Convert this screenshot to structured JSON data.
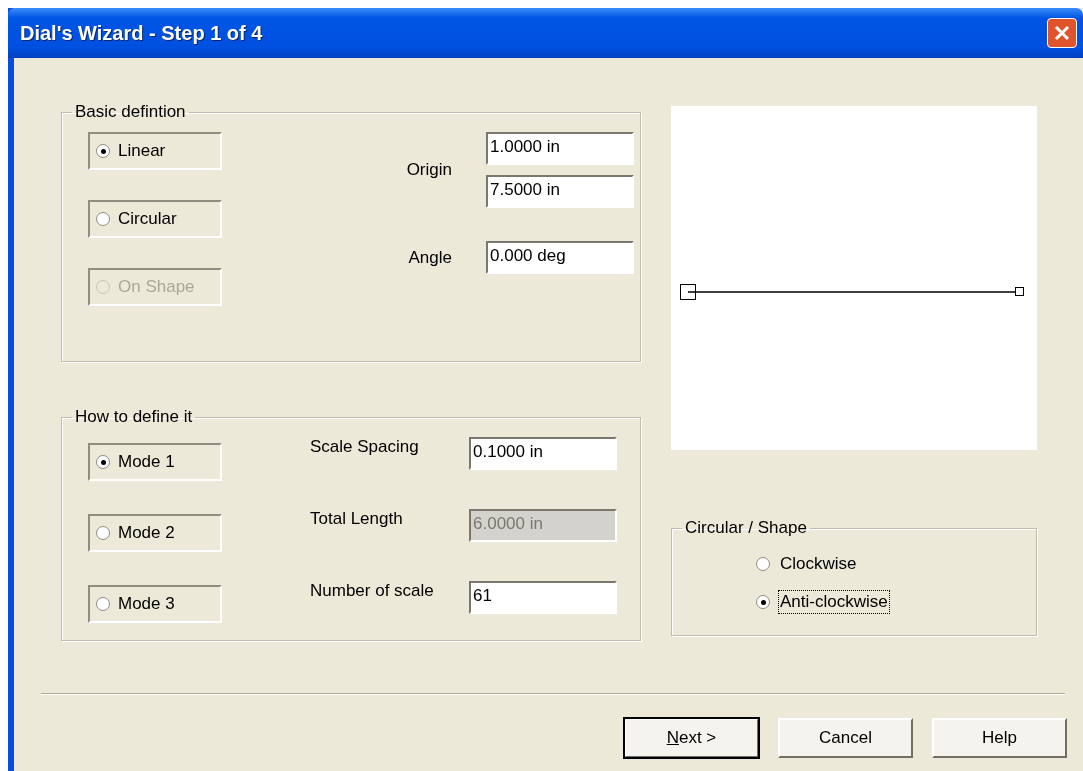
{
  "window": {
    "title": "Dial's Wizard - Step 1 of 4"
  },
  "basic_definition": {
    "title": "Basic defintion",
    "options": [
      {
        "label": "Linear",
        "selected": true,
        "disabled": false
      },
      {
        "label": "Circular",
        "selected": false,
        "disabled": false
      },
      {
        "label": "On Shape",
        "selected": false,
        "disabled": true
      }
    ],
    "fields": [
      {
        "label": "Origin",
        "values": [
          "1.0000 in",
          "7.5000 in"
        ]
      },
      {
        "label": "Angle",
        "values": [
          "0.000 deg"
        ]
      }
    ]
  },
  "how_to_define": {
    "title": "How to define it",
    "options": [
      {
        "label": "Mode 1",
        "selected": true
      },
      {
        "label": "Mode 2",
        "selected": false
      },
      {
        "label": "Mode 3",
        "selected": false
      }
    ],
    "fields": [
      {
        "label": "Scale Spacing",
        "value": "0.1000 in",
        "disabled": false
      },
      {
        "label": "Total Length",
        "value": "6.0000 in",
        "disabled": true
      },
      {
        "label": "Number of scale",
        "value": "61",
        "disabled": false
      }
    ]
  },
  "circular_shape": {
    "title": "Circular / Shape",
    "options": [
      {
        "label": "Clockwise",
        "selected": false,
        "focused": false
      },
      {
        "label": "Anti-clockwise",
        "selected": true,
        "focused": true
      }
    ]
  },
  "buttons": [
    {
      "label": "Next >",
      "default": true,
      "underline_first": true
    },
    {
      "label": "Cancel",
      "default": false,
      "underline_first": false
    },
    {
      "label": "Help",
      "default": false,
      "underline_first": false
    }
  ]
}
